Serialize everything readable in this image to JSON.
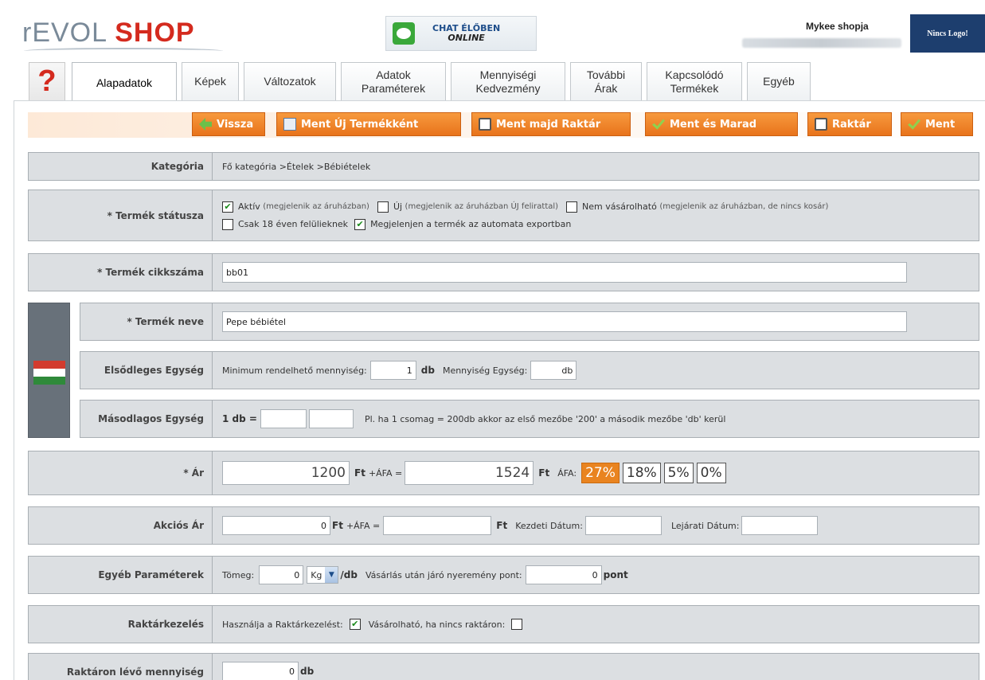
{
  "header": {
    "logo_part1": "rEVOL",
    "logo_part2": "SHOP",
    "chat_line1": "CHAT ÉLŐBEN",
    "chat_line2": "ONLINE",
    "shop_name": "Mykee shopja",
    "no_logo": "Nincs Logo!"
  },
  "help_label": "?",
  "tabs": [
    {
      "label": "Alapadatok",
      "active": true
    },
    {
      "label": "Képek"
    },
    {
      "label": "Változatok"
    },
    {
      "label": "Adatok Paraméterek"
    },
    {
      "label": "Mennyiségi Kedvezmény"
    },
    {
      "label": "További Árak"
    },
    {
      "label": "Kapcsolódó Termékek"
    },
    {
      "label": "Egyéb"
    }
  ],
  "toolbar": {
    "back": "Vissza",
    "save_new": "Ment Új Termékként",
    "save_stock": "Ment majd Raktár",
    "save_stay": "Ment és Marad",
    "stock": "Raktár",
    "save": "Ment"
  },
  "form": {
    "category": {
      "label": "Kategória",
      "value": "Fő kategória >Ételek >Bébiételek"
    },
    "status": {
      "label": "* Termék státusza",
      "active": "Aktív",
      "active_note": "(megjelenik az áruházban)",
      "new": "Új",
      "new_note": "(megjelenik az áruházban ÚJ felirattal)",
      "not_buyable": "Nem vásárolható",
      "not_buyable_note": "(megjelenik az áruházban, de nincs kosár)",
      "adult": "Csak 18 éven felülieknek",
      "export": "Megjelenjen a termék az automata exportban"
    },
    "sku": {
      "label": "* Termék cikkszáma",
      "value": "bb01"
    },
    "name": {
      "label": "* Termék neve",
      "value": "Pepe bébiétel"
    },
    "primary_unit": {
      "label": "Elsődleges Egység",
      "min_label": "Minimum rendelhető mennyiség:",
      "min_value": "1",
      "unit_db": "db",
      "unit_label": "Mennyiség Egység:",
      "unit_value": "db"
    },
    "secondary_unit": {
      "label": "Másodlagos Egység",
      "prefix": "1 db =",
      "hint": "Pl. ha 1 csomag = 200db akkor az első mezőbe '200' a második mezőbe 'db' kerül"
    },
    "price": {
      "label": "* Ár",
      "net": "1200",
      "ft": "Ft",
      "plus_vat": "+ÁFA =",
      "gross": "1524",
      "vat_label": "ÁFA:",
      "vat_options": [
        "27%",
        "18%",
        "5%",
        "0%"
      ]
    },
    "sale_price": {
      "label": "Akciós Ár",
      "net": "0",
      "ft": "Ft",
      "plus_vat": "+ÁFA =",
      "ft2": "Ft",
      "start_label": "Kezdeti Dátum:",
      "end_label": "Lejárati Dátum:"
    },
    "other_params": {
      "label": "Egyéb Paraméterek",
      "weight_label": "Tömeg:",
      "weight_value": "0",
      "weight_unit": "Kg",
      "per_db": "/db",
      "points_label": "Vásárlás után járó nyeremény pont:",
      "points_value": "0",
      "points_unit": "pont"
    },
    "stock_mgmt": {
      "label": "Raktárkezelés",
      "use_label": "Használja a Raktárkezelést:",
      "buyable_label": "Vásárolható, ha nincs raktáron:"
    },
    "stock_qty": {
      "label": "Raktáron lévő mennyiség",
      "value": "0",
      "unit": "db"
    }
  }
}
